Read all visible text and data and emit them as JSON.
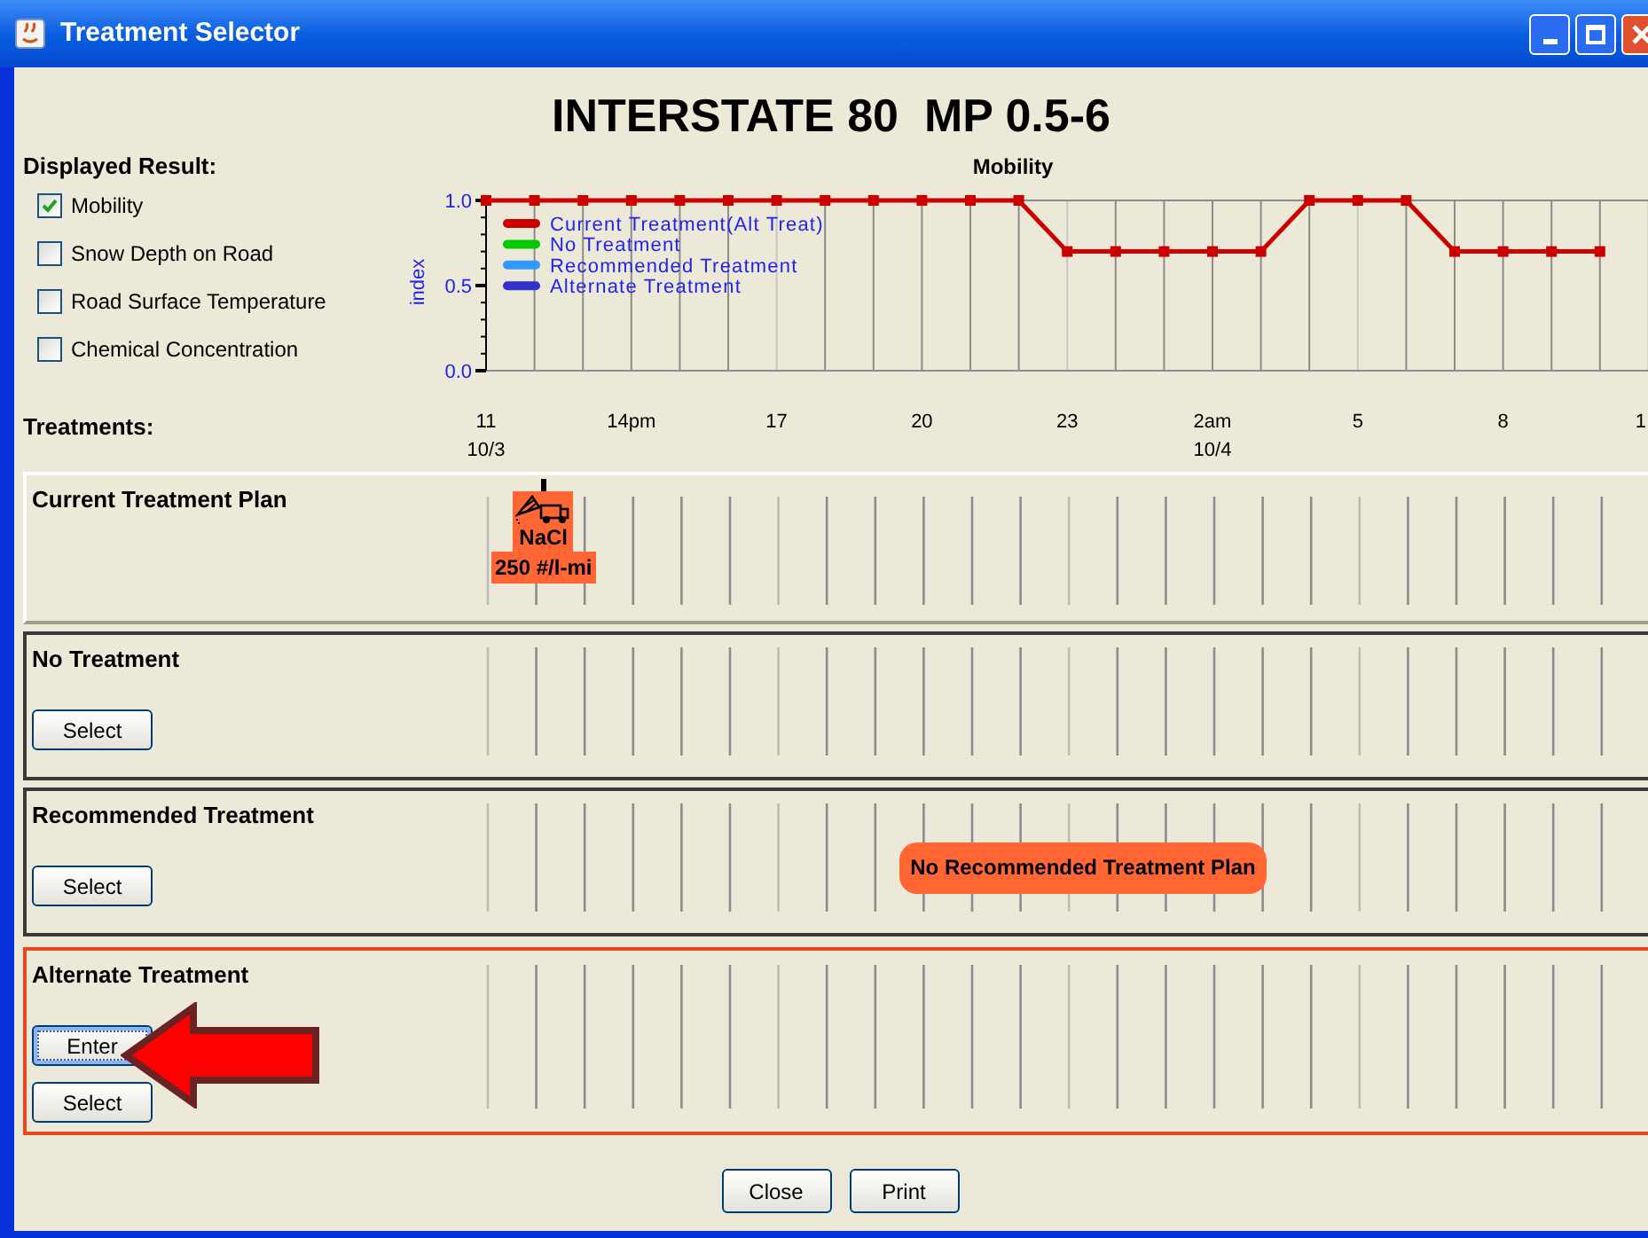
{
  "window": {
    "title": "Treatment Selector"
  },
  "heading": "INTERSTATE 80  MP 0.5-6",
  "displayed_result": {
    "label": "Displayed Result:",
    "options": [
      {
        "label": "Mobility",
        "checked": true
      },
      {
        "label": "Snow Depth on Road",
        "checked": false
      },
      {
        "label": "Road Surface Temperature",
        "checked": false
      },
      {
        "label": "Chemical Concentration",
        "checked": false
      }
    ]
  },
  "chart_data": {
    "type": "line",
    "title": "Mobility",
    "ylabel": "index",
    "ylim": [
      0,
      1
    ],
    "yticks": [
      {
        "value": 0,
        "label": "0.0"
      },
      {
        "value": 0.5,
        "label": "0.5"
      },
      {
        "value": 1,
        "label": "1.0"
      }
    ],
    "categories": [
      "11\n10/3",
      null,
      null,
      "14pm",
      null,
      null,
      "17",
      null,
      null,
      "20",
      null,
      null,
      "23",
      null,
      null,
      "2am\n10/4",
      null,
      null,
      "5",
      null,
      null,
      "8",
      null,
      null,
      "1"
    ],
    "grid": true,
    "series": [
      {
        "name": "Current Treatment(Alt Treat)",
        "color": "#cc0000",
        "marker": "square",
        "values": [
          1,
          1,
          1,
          1,
          1,
          1,
          1,
          1,
          1,
          1,
          1,
          1,
          0.7,
          0.7,
          0.7,
          0.7,
          0.7,
          1,
          1,
          1,
          0.7,
          0.7,
          0.7,
          0.7,
          null
        ]
      },
      {
        "name": "No Treatment",
        "color": "#00cc00",
        "values": [
          null,
          null,
          null,
          null,
          null,
          null,
          null,
          null,
          null,
          null,
          null,
          null,
          null,
          null,
          null,
          null,
          null,
          null,
          null,
          null,
          null,
          null,
          null,
          null,
          null
        ]
      },
      {
        "name": "Recommended Treatment",
        "color": "#3399ff",
        "values": [
          null,
          null,
          null,
          null,
          null,
          null,
          null,
          null,
          null,
          null,
          null,
          null,
          null,
          null,
          null,
          null,
          null,
          null,
          null,
          null,
          null,
          null,
          null,
          null,
          null
        ]
      },
      {
        "name": "Alternate Treatment",
        "color": "#3333cc",
        "values": [
          null,
          null,
          null,
          null,
          null,
          null,
          null,
          null,
          null,
          null,
          null,
          null,
          null,
          null,
          null,
          null,
          null,
          null,
          null,
          null,
          null,
          null,
          null,
          null,
          null
        ]
      }
    ]
  },
  "treatments_label": "Treatments:",
  "panels": [
    {
      "kind": "plan",
      "title": "Current Treatment Plan",
      "selected": false,
      "applications": [
        {
          "product": "NaCl",
          "rate": "250 #/l-mi"
        }
      ]
    },
    {
      "kind": "option",
      "title": "No Treatment",
      "selected": false,
      "buttons": [
        {
          "label": "Select",
          "focused": false
        }
      ]
    },
    {
      "kind": "option",
      "title": "Recommended Treatment",
      "selected": false,
      "buttons": [
        {
          "label": "Select",
          "focused": false
        }
      ],
      "message": "No Recommended Treatment Plan"
    },
    {
      "kind": "option",
      "title": "Alternate Treatment",
      "selected": true,
      "buttons": [
        {
          "label": "Enter",
          "focused": true
        },
        {
          "label": "Select",
          "focused": false
        }
      ]
    }
  ],
  "footer_buttons": [
    "Close",
    "Print"
  ]
}
